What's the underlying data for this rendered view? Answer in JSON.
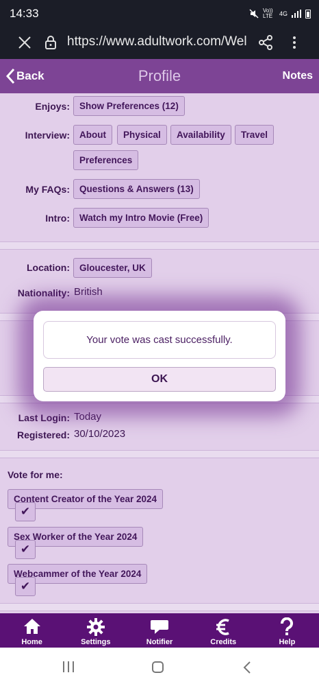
{
  "status_bar": {
    "time": "14:33",
    "network_volte": "Vo)) LTE",
    "network_type": "4G"
  },
  "browser": {
    "url": "https://www.adultwork.com/Wel"
  },
  "header": {
    "back_label": "Back",
    "title": "Profile",
    "notes_label": "Notes"
  },
  "profile": {
    "enjoys": {
      "label": "Enjoys:",
      "button": "Show Preferences (12)"
    },
    "interview": {
      "label": "Interview:",
      "buttons": [
        "About",
        "Physical",
        "Availability",
        "Travel",
        "Preferences"
      ]
    },
    "faqs": {
      "label": "My FAQs:",
      "button": "Questions & Answers (13)"
    },
    "intro": {
      "label": "Intro:",
      "button": "Watch my Intro Movie (Free)"
    },
    "location": {
      "label": "Location:",
      "value": "Gloucester, UK"
    },
    "nationality": {
      "label": "Nationality:",
      "value": "British"
    },
    "last_login": {
      "label": "Last Login:",
      "value": "Today"
    },
    "registered": {
      "label": "Registered:",
      "value": "30/10/2023"
    }
  },
  "vote": {
    "heading": "Vote for me:",
    "check_glyph": "✔",
    "categories": [
      "Content Creator of the Year 2024",
      "Sex Worker of the Year 2024",
      "Webcammer of the Year 2024"
    ]
  },
  "modal": {
    "message": "Your vote was cast successfully.",
    "ok_label": "OK"
  },
  "bottom_nav": [
    {
      "label": "Home",
      "icon": "home-icon"
    },
    {
      "label": "Settings",
      "icon": "gear-icon"
    },
    {
      "label": "Notifier",
      "icon": "chat-bubble-icon"
    },
    {
      "label": "Credits",
      "icon": "euro-icon"
    },
    {
      "label": "Help",
      "icon": "question-icon"
    }
  ],
  "colors": {
    "header": "#7d4495",
    "content_bg": "#e2cfea",
    "bottom_nav": "#5a1175",
    "accent_text": "#3d1652"
  }
}
